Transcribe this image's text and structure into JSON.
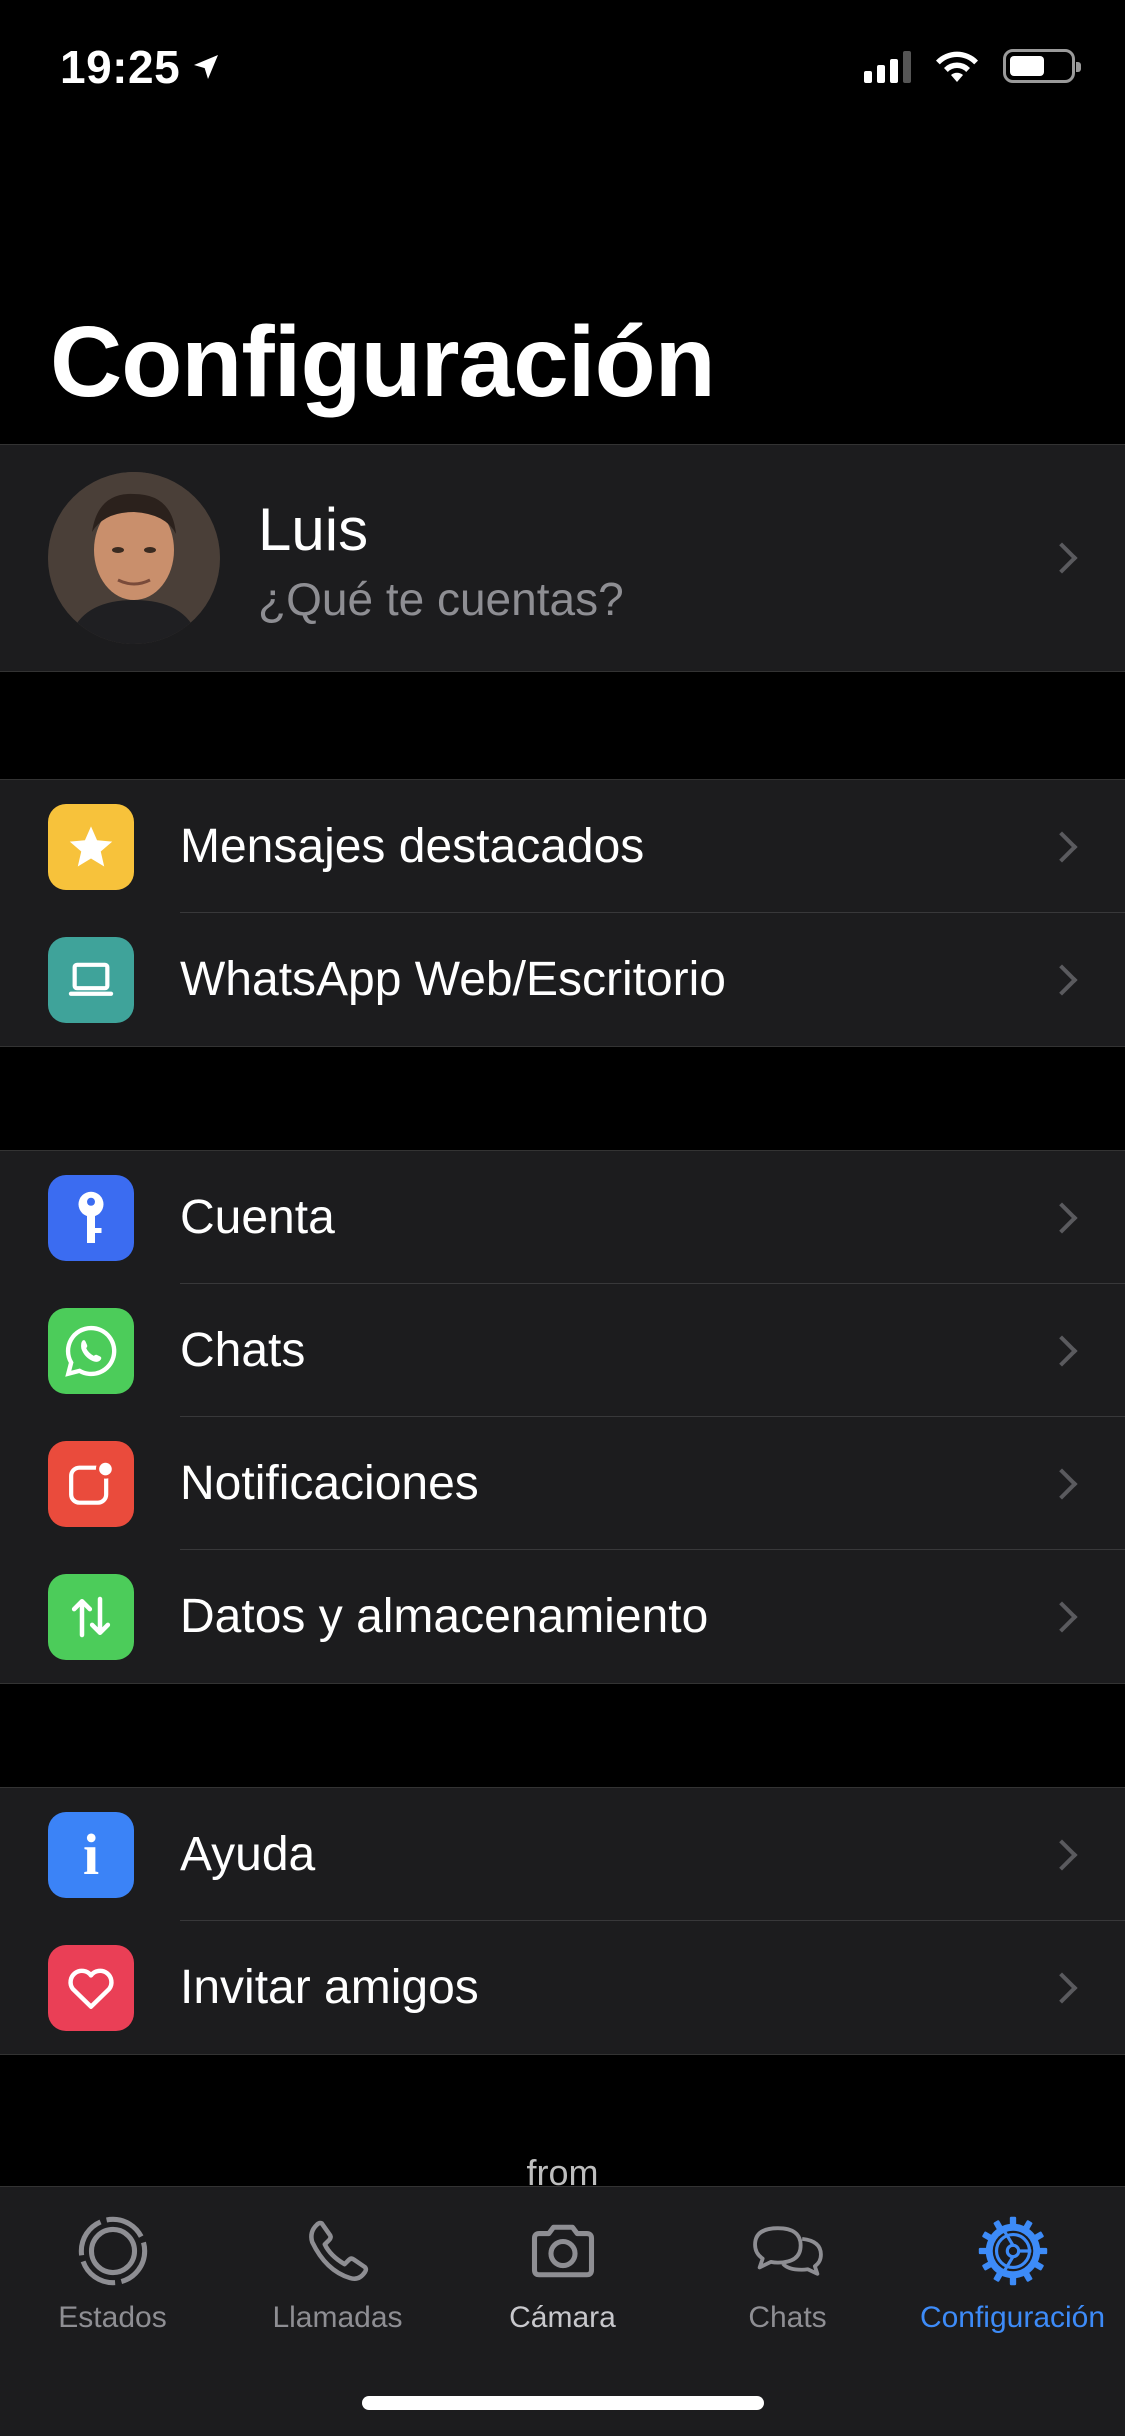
{
  "status_bar": {
    "time": "19:25"
  },
  "title": "Configuración",
  "profile": {
    "name": "Luis",
    "status": "¿Qué te cuentas?"
  },
  "groups": [
    [
      {
        "label": "Mensajes destacados",
        "icon": "star-icon",
        "color": "#f7c23b"
      },
      {
        "label": "WhatsApp Web/Escritorio",
        "icon": "laptop-icon",
        "color": "#3fa39a"
      }
    ],
    [
      {
        "label": "Cuenta",
        "icon": "key-icon",
        "color": "#3b6cf1"
      },
      {
        "label": "Chats",
        "icon": "whatsapp-icon",
        "color": "#4ccc5a"
      },
      {
        "label": "Notificaciones",
        "icon": "notification-icon",
        "color": "#ea4b3c"
      },
      {
        "label": "Datos y almacenamiento",
        "icon": "data-transfer-icon",
        "color": "#4ccc5a"
      }
    ],
    [
      {
        "label": "Ayuda",
        "icon": "info-icon",
        "color": "#3b83f7"
      },
      {
        "label": "Invitar amigos",
        "icon": "heart-icon",
        "color": "#ea3f56"
      }
    ]
  ],
  "footer": {
    "from": "from"
  },
  "tabs": [
    {
      "label": "Estados",
      "icon": "status-icon"
    },
    {
      "label": "Llamadas",
      "icon": "phone-icon"
    },
    {
      "label": "Cámara",
      "icon": "camera-icon"
    },
    {
      "label": "Chats",
      "icon": "chats-icon"
    },
    {
      "label": "Configuración",
      "icon": "settings-gear-icon",
      "active": true
    }
  ],
  "accent_color": "#3d8bf8"
}
